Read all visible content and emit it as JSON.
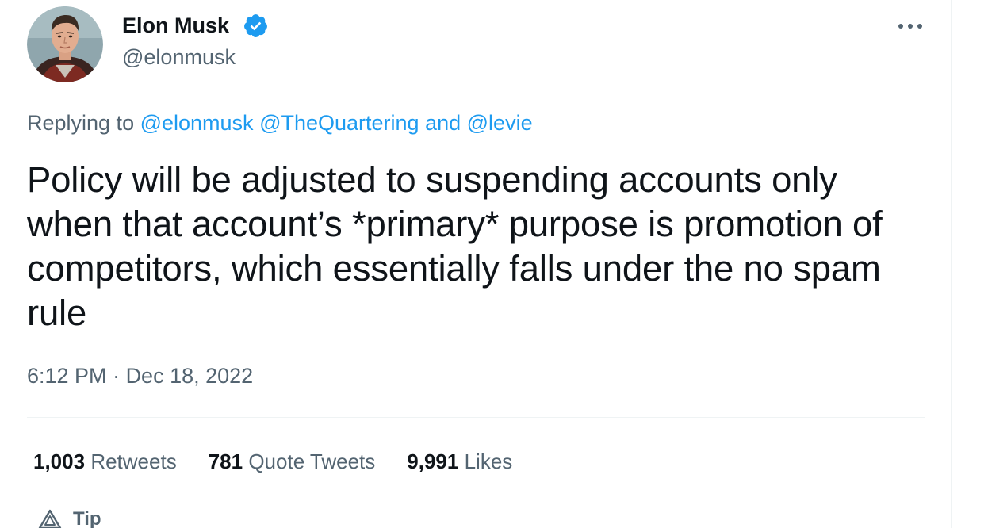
{
  "author": {
    "display_name": "Elon Musk",
    "handle": "@elonmusk",
    "verified": true,
    "avatar_icon": "avatar-photo"
  },
  "more_icon": "more-horizontal-icon",
  "reply": {
    "prefix": "Replying to ",
    "mention_1": "@elonmusk",
    "mention_2": "@TheQuartering",
    "conjunction": " and ",
    "mention_3": "@levie"
  },
  "tweet": {
    "text": "Policy will be adjusted to suspending accounts only when that account’s *primary* purpose is promotion of competitors, which essentially falls under the no spam rule"
  },
  "meta": {
    "time": "6:12 PM",
    "separator": " · ",
    "date": "Dec 18, 2022"
  },
  "stats": {
    "retweets_count": "1,003",
    "retweets_label": "Retweets",
    "quotes_count": "781",
    "quotes_label": "Quote Tweets",
    "likes_count": "9,991",
    "likes_label": "Likes"
  },
  "actions": {
    "tip_label": "Tip"
  },
  "colors": {
    "accent": "#1d9bf0",
    "text_primary": "#0f1419",
    "text_secondary": "#536471",
    "divider": "#eff3f4"
  }
}
